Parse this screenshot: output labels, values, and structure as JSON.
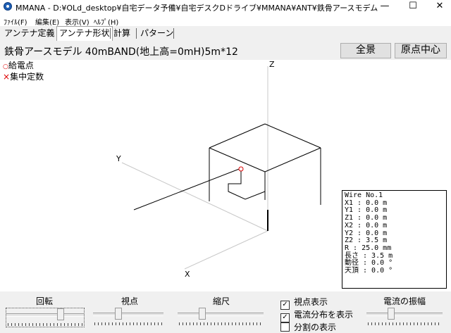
{
  "window": {
    "title": "MMANA - D:¥OLd_desktop¥自宅データ予備¥自宅デスクDドライブ¥MMANA¥ANT¥鉄骨アースモデム",
    "minimize": "—",
    "maximize": "☐",
    "close": "✕"
  },
  "menu": [
    "ﾌｧｲﾙ(F)",
    "編集(E)",
    "表示(V)",
    "ﾍﾙﾌﾟ(H)"
  ],
  "tabs": [
    {
      "label": "アンテナ定義",
      "active": false
    },
    {
      "label": "アンテナ形状",
      "active": true
    },
    {
      "label": "計算",
      "active": false
    },
    {
      "label": "パターン",
      "active": false
    }
  ],
  "header": {
    "model_title": "鉄骨アースモデル 40mBAND(地上高=0mH)5m*12",
    "btn_full_view": "全景",
    "btn_origin_center": "原点中心"
  },
  "legend": {
    "feed_symbol": "○",
    "feed_label": "給電点",
    "load_symbol": "×",
    "load_label": "集中定数"
  },
  "axes": {
    "x": "X",
    "y": "Y",
    "z": "Z"
  },
  "info": {
    "lines": [
      "Wire No.1",
      "X1   : 0.0 m",
      "Y1   : 0.0 m",
      "Z1   : 0.0 m",
      "X2   : 0.0 m",
      "Y2   : 0.0 m",
      "Z2   : 3.5 m",
      "R    : 25.0 mm",
      "長さ : 3.5 m",
      "動径 : 0.0 °",
      "天頂 : 0.0 °"
    ]
  },
  "controls": {
    "rotate_label": "回転",
    "viewpoint_label": "視点",
    "scale_label": "縮尺",
    "current_amp_label": "電流の振幅",
    "show_viewpoint": {
      "label": "視点表示",
      "checked": true
    },
    "show_current": {
      "label": "電流分布を表示",
      "checked": true
    },
    "show_segments": {
      "label": "分割の表示",
      "checked": false
    }
  },
  "colors": {
    "feed": "#dd0000",
    "load": "#dd0000"
  }
}
